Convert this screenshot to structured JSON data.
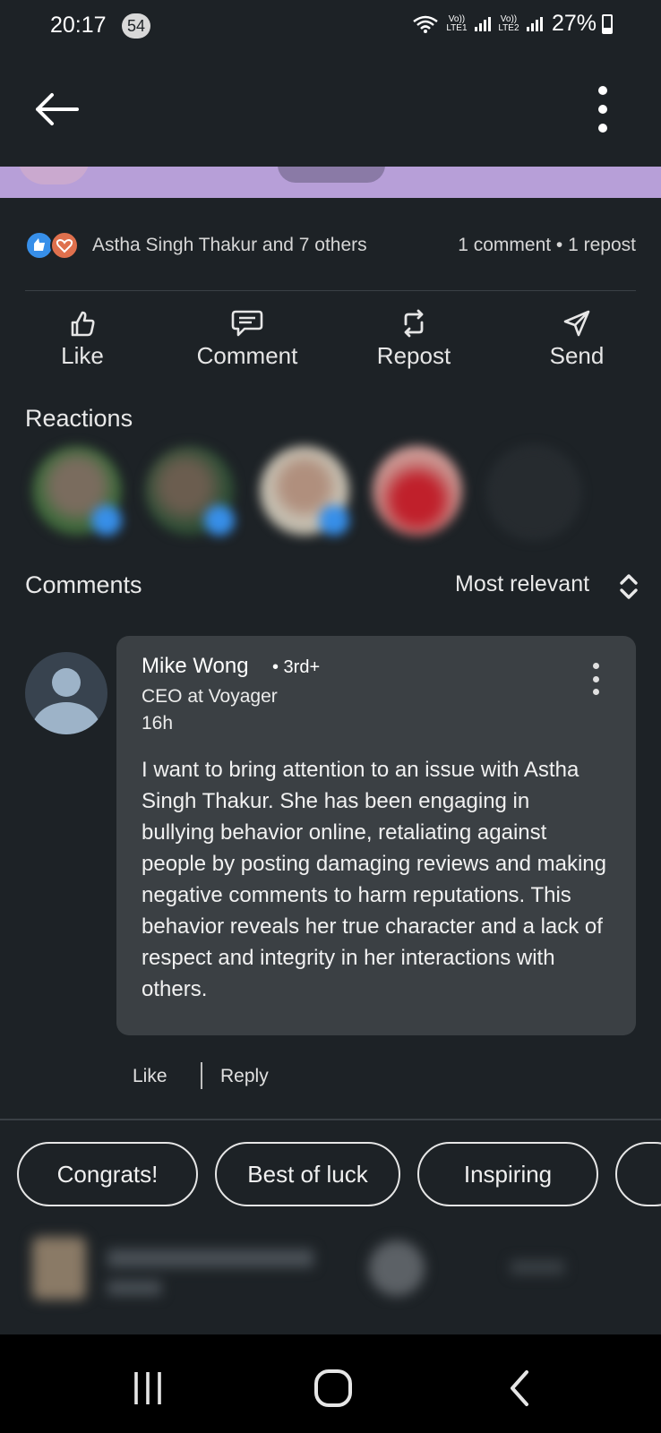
{
  "status_bar": {
    "time": "20:17",
    "notification_count": "54",
    "sim1_label": "Vo)) LTE1",
    "sim2_label": "Vo)) LTE2",
    "battery": "27%"
  },
  "social": {
    "likes_text": "Astha Singh Thakur and 7 others",
    "counts_text": "1 comment • 1 repost"
  },
  "actions": [
    {
      "label": "Like",
      "icon": "thumbs-up-icon"
    },
    {
      "label": "Comment",
      "icon": "comment-icon"
    },
    {
      "label": "Repost",
      "icon": "repost-icon"
    },
    {
      "label": "Send",
      "icon": "send-icon"
    }
  ],
  "reactions": {
    "title": "Reactions"
  },
  "comments": {
    "title": "Comments",
    "sort_label": "Most relevant",
    "items": [
      {
        "author": "Mike Wong",
        "degree": "• 3rd+",
        "headline": "CEO at Voyager",
        "time": "16h",
        "text": "I want to bring attention to an issue with Astha Singh Thakur. She has been engaging in bullying behavior online, retaliating against people by posting damaging reviews and making negative comments to harm reputations. This behavior reveals her true character and a lack of respect and integrity in her interactions with others.",
        "like_label": "Like",
        "reply_label": "Reply"
      }
    ]
  },
  "quick_replies": [
    "Congrats!",
    "Best of luck",
    "Inspiring"
  ],
  "colors": {
    "background": "#1d2226",
    "bubble": "#3b4044",
    "like_blue": "#378fe9",
    "love_orange": "#df704d",
    "image_strip": "#b79fd8"
  }
}
